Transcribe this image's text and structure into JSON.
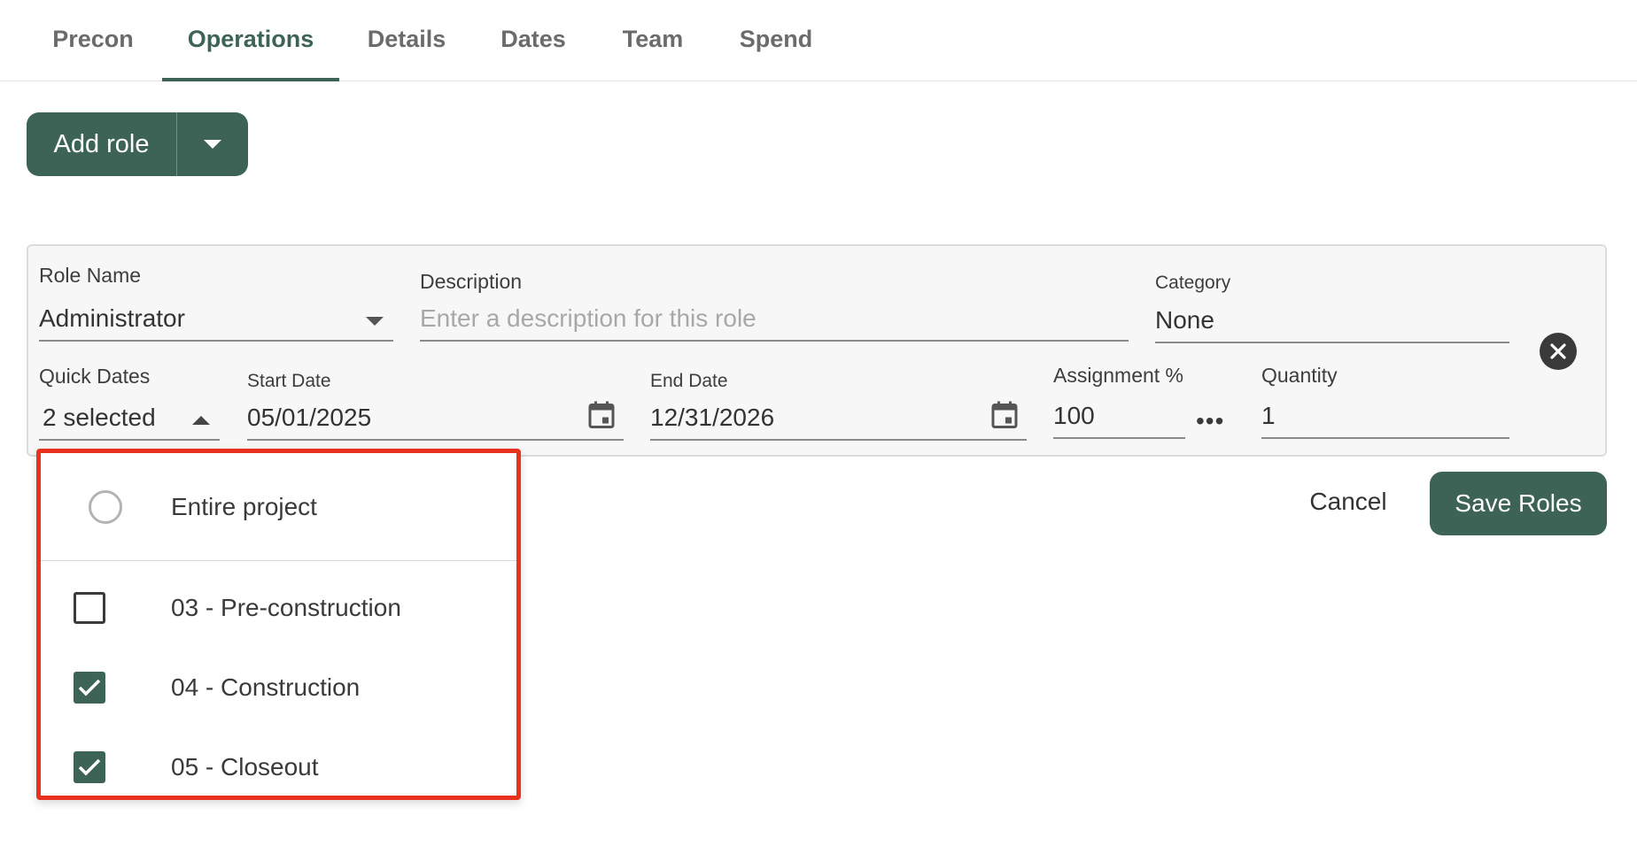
{
  "tabs": [
    {
      "label": "Precon",
      "active": false
    },
    {
      "label": "Operations",
      "active": true
    },
    {
      "label": "Details",
      "active": false
    },
    {
      "label": "Dates",
      "active": false
    },
    {
      "label": "Team",
      "active": false
    },
    {
      "label": "Spend",
      "active": false
    }
  ],
  "add_role": {
    "label": "Add role",
    "caret_icon": "caret-down-icon"
  },
  "form": {
    "role_name": {
      "label": "Role Name",
      "value": "Administrator"
    },
    "description": {
      "label": "Description",
      "value": "",
      "placeholder": "Enter a description for this role"
    },
    "category": {
      "label": "Category",
      "value": "None"
    },
    "quick_dates": {
      "label": "Quick Dates",
      "value": "2 selected"
    },
    "start_date": {
      "label": "Start Date",
      "value": "05/01/2025"
    },
    "end_date": {
      "label": "End Date",
      "value": "12/31/2026"
    },
    "assignment": {
      "label": "Assignment %",
      "value": "100",
      "more": "•••"
    },
    "quantity": {
      "label": "Quantity",
      "value": "1"
    }
  },
  "actions": {
    "cancel": "Cancel",
    "save": "Save Roles"
  },
  "quick_dates_menu": {
    "entire_project": {
      "label": "Entire project",
      "selected": false
    },
    "options": [
      {
        "label": "03 - Pre-construction",
        "checked": false
      },
      {
        "label": "04 - Construction",
        "checked": true
      },
      {
        "label": "05 - Closeout",
        "checked": true
      }
    ]
  },
  "colors": {
    "accent": "#3d6356",
    "highlight_border": "#e8321d"
  }
}
